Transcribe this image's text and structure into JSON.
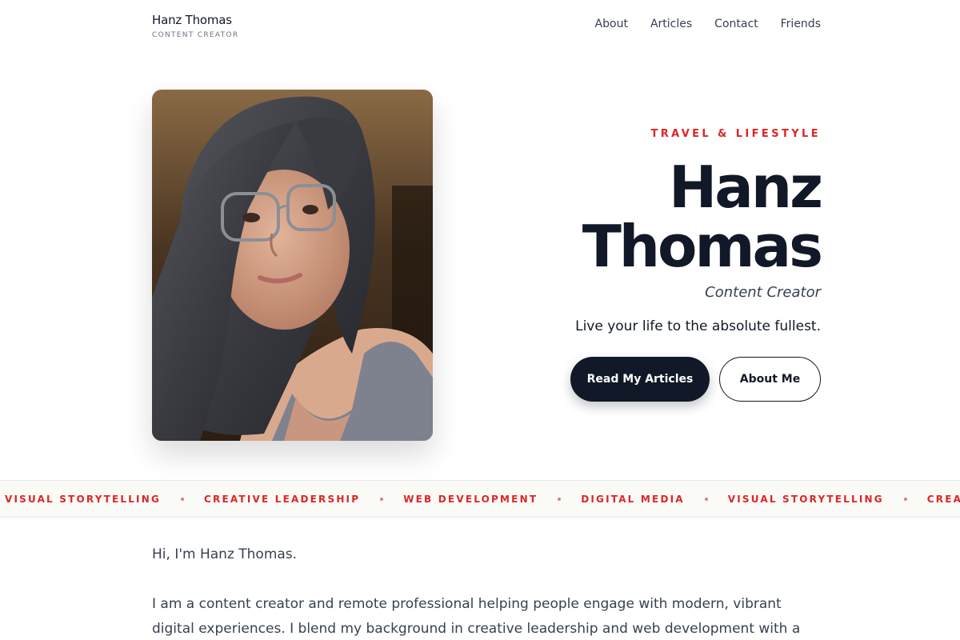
{
  "header": {
    "brand_name": "Hanz Thomas",
    "brand_tagline": "CONTENT CREATOR",
    "nav": [
      {
        "label": "About"
      },
      {
        "label": "Articles"
      },
      {
        "label": "Contact"
      },
      {
        "label": "Friends"
      }
    ]
  },
  "hero": {
    "eyebrow": "TRAVEL & LIFESTYLE",
    "title_line1": "Hanz",
    "title_line2": "Thomas",
    "subtitle": "Content Creator",
    "tagline": "Live your life to the absolute fullest.",
    "primary_button": "Read My Articles",
    "secondary_button": "About Me"
  },
  "ticker": {
    "items": [
      "VISUAL STORYTELLING",
      "CREATIVE LEADERSHIP",
      "WEB DEVELOPMENT",
      "DIGITAL MEDIA",
      "VISUAL STORYTELLING",
      "CREATIVE LEADERSHIP"
    ]
  },
  "intro": {
    "greeting": "Hi, I'm Hanz Thomas.",
    "body": "I am a content creator and remote professional helping people engage with modern, vibrant digital experiences. I blend my background in creative leadership and web development with a"
  },
  "colors": {
    "accent": "#dc2626",
    "dark": "#111827",
    "ticker_bg": "#fafaf7"
  }
}
